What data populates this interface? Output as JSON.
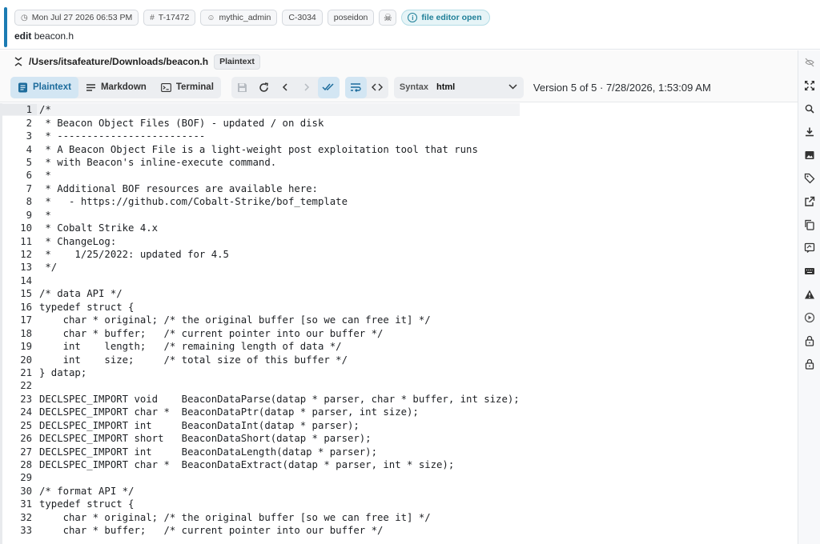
{
  "header": {
    "chips": {
      "timestamp": "Mon Jul 27 2026 06:53 PM",
      "task": "T-17472",
      "user": "mythic_admin",
      "callback": "C-3034",
      "host": "poseidon"
    },
    "status": "file editor open",
    "command": "edit",
    "command_arg": "beacon.h"
  },
  "filebar": {
    "path": "/Users/itsafeature/Downloads/beacon.h",
    "mode_badge": "Plaintext"
  },
  "toolbar": {
    "modes": [
      {
        "label": "Plaintext",
        "icon": "document-icon",
        "active": true
      },
      {
        "label": "Markdown",
        "icon": "lines-icon",
        "active": false
      },
      {
        "label": "Terminal",
        "icon": "terminal-icon",
        "active": false
      }
    ],
    "syntax_label": "Syntax",
    "syntax_value": "html",
    "version": "Version 5 of 5 · 7/28/2026, 1:53:09 AM"
  },
  "editor": {
    "current_line": 1,
    "lines": [
      {
        "n": "1",
        "t": "/*"
      },
      {
        "n": "2",
        "t": " * Beacon Object Files (BOF) - updated / on disk"
      },
      {
        "n": "3",
        "t": " * -------------------------"
      },
      {
        "n": "4",
        "t": " * A Beacon Object File is a light-weight post exploitation tool that runs"
      },
      {
        "n": "5",
        "t": " * with Beacon's inline-execute command."
      },
      {
        "n": "6",
        "t": " *"
      },
      {
        "n": "7",
        "t": " * Additional BOF resources are available here:"
      },
      {
        "n": "8",
        "t": " *   - https://github.com/Cobalt-Strike/bof_template"
      },
      {
        "n": "9",
        "t": " *"
      },
      {
        "n": "10",
        "t": " * Cobalt Strike 4.x"
      },
      {
        "n": "11",
        "t": " * ChangeLog:"
      },
      {
        "n": "12",
        "t": " *    1/25/2022: updated for 4.5"
      },
      {
        "n": "13",
        "t": " */"
      },
      {
        "n": "14",
        "t": ""
      },
      {
        "n": "15",
        "t": "/* data API */"
      },
      {
        "n": "16",
        "t": "typedef struct {"
      },
      {
        "n": "17",
        "t": "    char * original; /* the original buffer [so we can free it] */"
      },
      {
        "n": "18",
        "t": "    char * buffer;   /* current pointer into our buffer */"
      },
      {
        "n": "19",
        "t": "    int    length;   /* remaining length of data */"
      },
      {
        "n": "20",
        "t": "    int    size;     /* total size of this buffer */"
      },
      {
        "n": "21",
        "t": "} datap;"
      },
      {
        "n": "22",
        "t": ""
      },
      {
        "n": "23",
        "t": "DECLSPEC_IMPORT void    BeaconDataParse(datap * parser, char * buffer, int size);"
      },
      {
        "n": "24",
        "t": "DECLSPEC_IMPORT char *  BeaconDataPtr(datap * parser, int size);"
      },
      {
        "n": "25",
        "t": "DECLSPEC_IMPORT int     BeaconDataInt(datap * parser);"
      },
      {
        "n": "26",
        "t": "DECLSPEC_IMPORT short   BeaconDataShort(datap * parser);"
      },
      {
        "n": "27",
        "t": "DECLSPEC_IMPORT int     BeaconDataLength(datap * parser);"
      },
      {
        "n": "28",
        "t": "DECLSPEC_IMPORT char *  BeaconDataExtract(datap * parser, int * size);"
      },
      {
        "n": "29",
        "t": ""
      },
      {
        "n": "30",
        "t": "/* format API */"
      },
      {
        "n": "31",
        "t": "typedef struct {"
      },
      {
        "n": "32",
        "t": "    char * original; /* the original buffer [so we can free it] */"
      },
      {
        "n": "33",
        "t": "    char * buffer;   /* current pointer into our buffer */"
      }
    ]
  },
  "sidebar_icons": [
    "eye-off-icon",
    "expand-icon",
    "search-icon",
    "download-icon",
    "image-icon",
    "tag-icon",
    "external-link-icon",
    "copy-icon",
    "comment-icon",
    "keyboard-icon",
    "warning-icon",
    "play-circle-icon",
    "lock-icon",
    "lock-icon"
  ]
}
